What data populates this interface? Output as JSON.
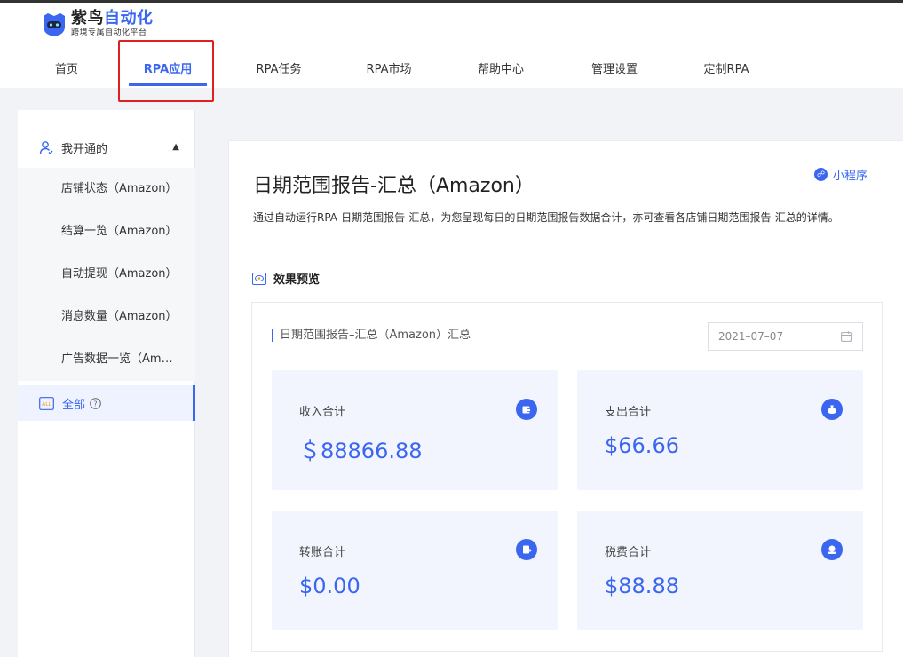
{
  "brand": {
    "title_part1": "紫鸟",
    "title_part2": "自动化",
    "subtitle": "跨境专属自动化平台"
  },
  "nav": [
    {
      "label": "首页",
      "active": false
    },
    {
      "label": "RPA应用",
      "active": true
    },
    {
      "label": "RPA任务",
      "active": false
    },
    {
      "label": "RPA市场",
      "active": false
    },
    {
      "label": "帮助中心",
      "active": false
    },
    {
      "label": "管理设置",
      "active": false
    },
    {
      "label": "定制RPA",
      "active": false
    }
  ],
  "sidebar": {
    "group_label": "我开通的",
    "items": [
      {
        "label": "店铺状态（Amazon）"
      },
      {
        "label": "结算一览（Amazon）"
      },
      {
        "label": "自动提现（Amazon）"
      },
      {
        "label": "消息数量（Amazon）"
      },
      {
        "label": "广告数据一览（Amazon）"
      }
    ],
    "all_label": "全部",
    "all_icon_text": "ALL"
  },
  "main": {
    "title": "日期范围报告-汇总（Amazon）",
    "mini_program": "小程序",
    "description": "通过自动运行RPA-日期范围报告-汇总，为您呈现每日的日期范围报告数据合计，亦可查看各店铺日期范围报告-汇总的详情。",
    "preview_label": "效果预览"
  },
  "preview": {
    "title": "日期范围报告–汇总（Amazon）汇总",
    "date": "2021–07–07",
    "cards": [
      {
        "label": "收入合计",
        "value": "＄88866.88",
        "icon": "wallet-icon"
      },
      {
        "label": "支出合计",
        "value": "$66.66",
        "icon": "money-bag-icon"
      },
      {
        "label": "转账合计",
        "value": "$0.00",
        "icon": "transfer-icon"
      },
      {
        "label": "税费合计",
        "value": "$88.88",
        "icon": "tax-icon"
      }
    ]
  },
  "colors": {
    "accent": "#3a66f0",
    "highlight_box": "#e02020"
  }
}
